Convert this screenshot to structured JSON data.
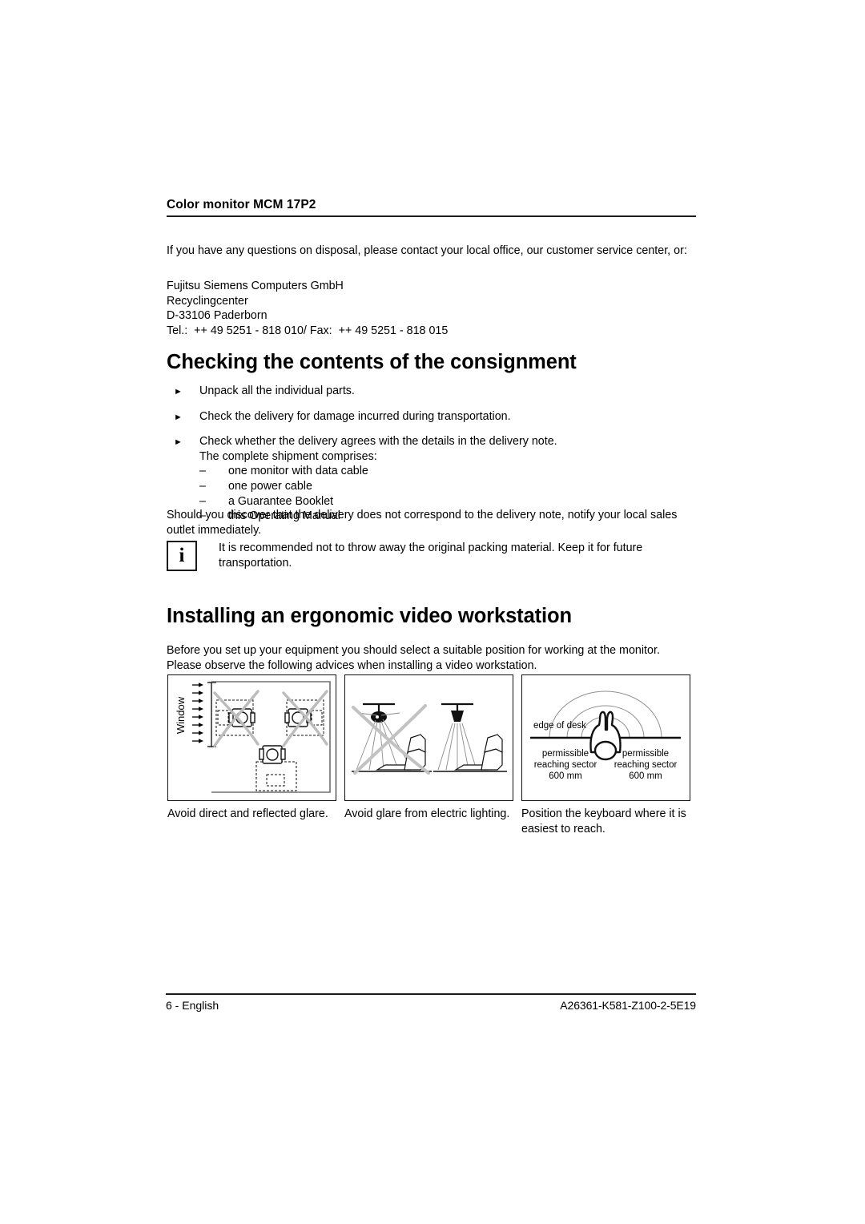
{
  "header": {
    "title": "Color monitor MCM 17P2"
  },
  "intro": {
    "paragraph": "If you have any questions on disposal, please contact your local office, our customer service center, or:",
    "address": [
      "Fujitsu Siemens Computers GmbH",
      "Recyclingcenter",
      "D-33106 Paderborn",
      "Tel.:  ++ 49 5251 - 818 010/ Fax:  ++ 49 5251 - 818 015"
    ]
  },
  "section_consignment": {
    "heading": "Checking the contents of the consignment",
    "bullet_marker": "►",
    "bullets": [
      {
        "text": "Unpack all the individual parts."
      },
      {
        "text": "Check the delivery for damage incurred during transportation."
      },
      {
        "text": "Check whether the delivery agrees with the details in the delivery note.",
        "subtext": "The complete shipment comprises:",
        "dash_marker": "–",
        "items": [
          "one monitor with data cable",
          "one power cable",
          "a Guarantee Booklet",
          "this Operating Manual"
        ]
      }
    ],
    "closing": "Should you discover that the delivery does not correspond to the delivery note, notify your local sales outlet immediately.",
    "note": {
      "icon": "i",
      "text": "It is recommended not to throw away the original packing material. Keep it for future transportation."
    }
  },
  "section_workstation": {
    "heading": "Installing an ergonomic video workstation",
    "intro": "Before you set up your equipment you should select a suitable position for working at the monitor. Please observe the following advices when installing a video workstation.",
    "figures": [
      {
        "id": "room-layout",
        "caption": "Avoid direct and reflected glare.",
        "labels": {
          "window": "Window"
        }
      },
      {
        "id": "ceiling-lighting",
        "caption": "Avoid glare from electric lighting.",
        "labels": {}
      },
      {
        "id": "reach-sector",
        "caption": "Position the keyboard where it is easiest to reach.",
        "labels": {
          "edge_of_desk": "edge of desk",
          "left_sector_line1": "permissible",
          "left_sector_line2": "reaching sector",
          "left_sector_line3": "600 mm",
          "right_sector_line1": "permissible",
          "right_sector_line2": "reaching sector",
          "right_sector_line3": "600 mm"
        }
      }
    ]
  },
  "footer": {
    "left": "6 - English",
    "right": "A26361-K581-Z100-2-5E19"
  },
  "colors": {
    "ink": "#000000",
    "rule": "#1a1a1a",
    "grey_stroke": "#b9b9b9",
    "light_stroke": "#9a9a9a"
  }
}
